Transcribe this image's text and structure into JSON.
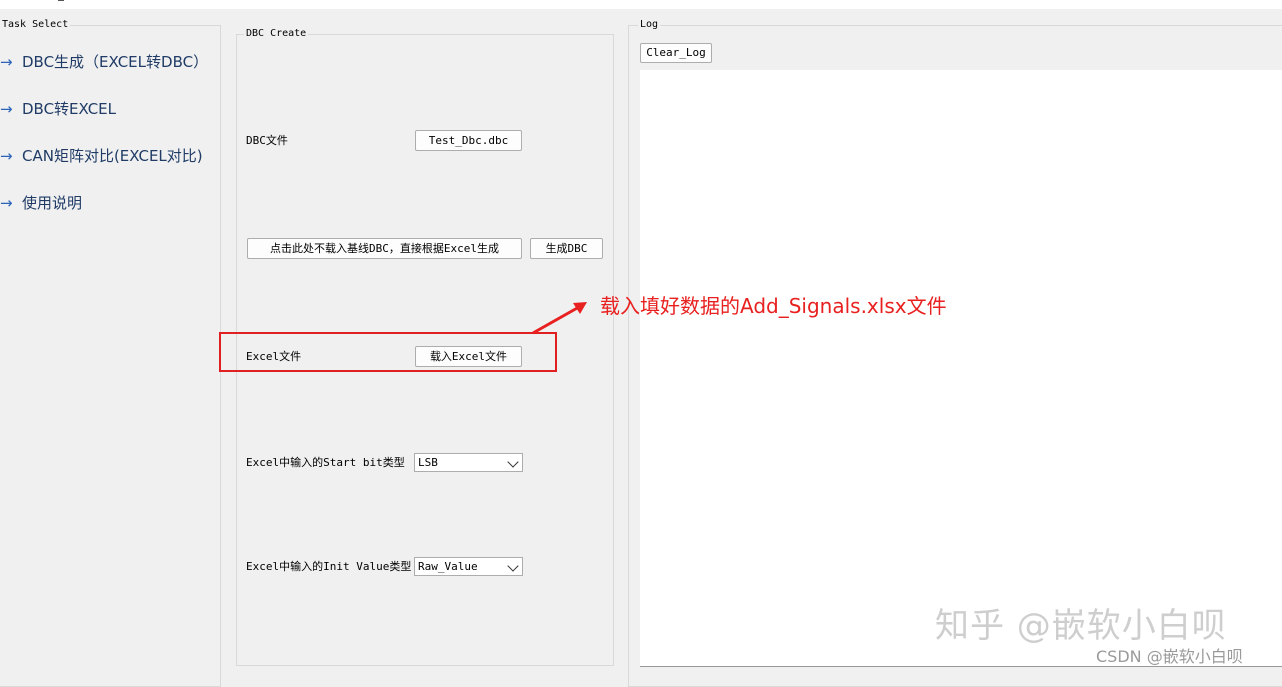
{
  "task_select": {
    "title": "Task Select",
    "items": [
      {
        "label": "DBC生成（EXCEL转DBC）"
      },
      {
        "label": "DBC转EXCEL"
      },
      {
        "label": "CAN矩阵对比(EXCEL对比)"
      },
      {
        "label": "使用说明"
      }
    ]
  },
  "dbc_create": {
    "title": "DBC Create",
    "dbc_file_label": "DBC文件",
    "dbc_file_button": "Test_Dbc.dbc",
    "no_baseline_button": "点击此处不载入基线DBC，直接根据Excel生成",
    "generate_button": "生成DBC",
    "excel_file_label": "Excel文件",
    "load_excel_button": "载入Excel文件",
    "start_bit_label": "Excel中输入的Start bit类型",
    "start_bit_value": "LSB",
    "init_value_label": "Excel中输入的Init Value类型",
    "init_value_value": "Raw_Value"
  },
  "log": {
    "title": "Log",
    "clear_button": "Clear_Log"
  },
  "annotation": {
    "text": "载入填好数据的Add_Signals.xlsx文件",
    "color": "#e8201f"
  },
  "watermark": {
    "large": "知乎 @嵌软小白呗",
    "small": "CSDN @嵌软小白呗"
  }
}
